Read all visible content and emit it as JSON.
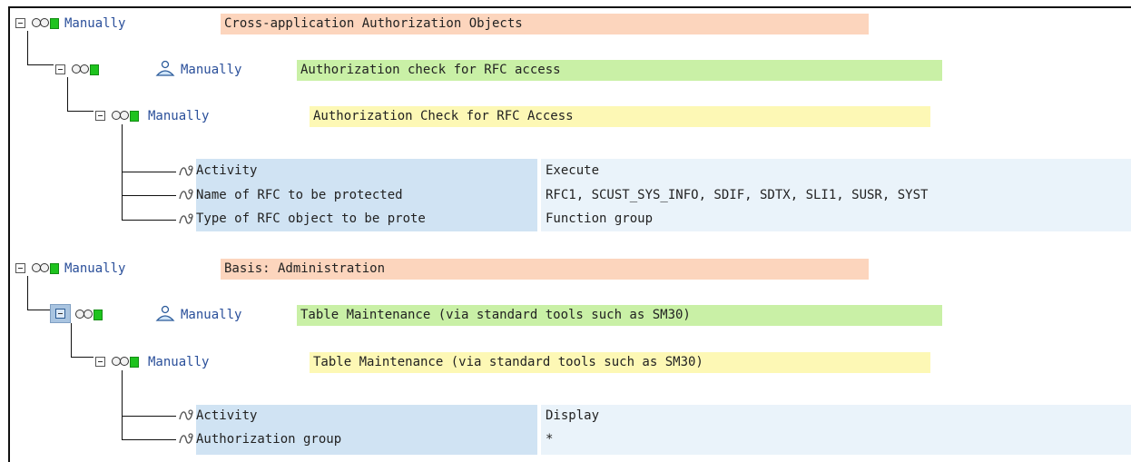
{
  "tree": {
    "nodes": [
      {
        "status": "Manually",
        "text": "Cross-application Authorization Objects"
      },
      {
        "status": "Manually",
        "text": "Authorization check for RFC access"
      },
      {
        "status": "Manually",
        "text": "Authorization Check for RFC Access"
      },
      {
        "status": "Manually",
        "text": "Basis: Administration"
      },
      {
        "status": "Manually",
        "text": "Table Maintenance (via standard tools such as SM30)"
      },
      {
        "status": "Manually",
        "text": "Table Maintenance (via standard tools such as SM30)"
      }
    ],
    "fields": [
      {
        "name": "Activity",
        "value": "Execute"
      },
      {
        "name": "Name of RFC to be protected",
        "value": "RFC1, SCUST_SYS_INFO, SDIF, SDTX, SLI1, SUSR, SYST"
      },
      {
        "name": "Type of RFC object to be prote",
        "value": "Function group"
      },
      {
        "name": "Activity",
        "value": "Display"
      },
      {
        "name": "Authorization group",
        "value": "*"
      }
    ]
  },
  "icons": {
    "expander": "collapse-node-icon",
    "lights": "traffic-light-icon",
    "person": "person-icon",
    "field": "field-values-icon"
  },
  "colors": {
    "level1_band": "#fcd5bd",
    "level2_band": "#c9f0a6",
    "level3_band": "#fdf8b5",
    "field_band": "#d0e3f3",
    "value_band": "#eaf3fa",
    "status_text": "#2a4f9a",
    "green_light": "#1ec31e"
  }
}
